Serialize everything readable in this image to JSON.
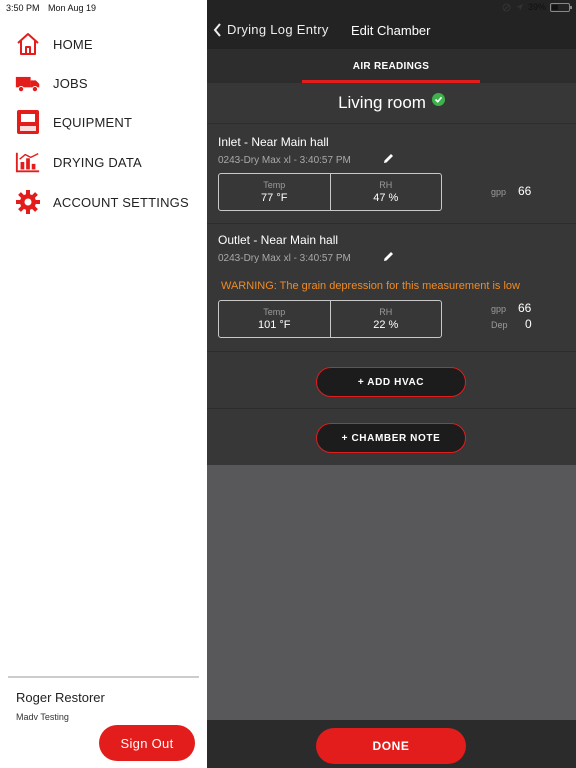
{
  "status_bar": {
    "time": "3:50 PM",
    "date": "Mon Aug 19",
    "battery": "39%"
  },
  "sidebar": {
    "items": [
      {
        "label": "HOME",
        "icon": "home-icon"
      },
      {
        "label": "JOBS",
        "icon": "truck-icon"
      },
      {
        "label": "EQUIPMENT",
        "icon": "dehumidifier-icon"
      },
      {
        "label": "DRYING DATA",
        "icon": "chart-icon"
      },
      {
        "label": "ACCOUNT SETTINGS",
        "icon": "gear-icon"
      }
    ],
    "user_name": "Roger Restorer",
    "user_org": "Madv Testing",
    "sign_out_label": "Sign Out"
  },
  "header": {
    "back_label": "Drying Log Entry",
    "title": "Edit Chamber"
  },
  "tabs": {
    "active": "AIR READINGS"
  },
  "chamber": {
    "name": "Living room",
    "readings": [
      {
        "name": "Inlet - Near Main hall",
        "equipment": "0243-Dry Max xl - 3:40:57 PM",
        "temp_label": "Temp",
        "temp_value": "77 °F",
        "rh_label": "RH",
        "rh_value": "47 %",
        "gpp_label": "gpp",
        "gpp_value": "66"
      },
      {
        "name": "Outlet - Near Main hall",
        "equipment": "0243-Dry Max xl - 3:40:57 PM",
        "warning": "WARNING: The grain depression for this measurement is low",
        "temp_label": "Temp",
        "temp_value": "101 °F",
        "rh_label": "RH",
        "rh_value": "22 %",
        "gpp_label": "gpp",
        "gpp_value": "66",
        "dep_label": "Dep",
        "dep_value": "0"
      }
    ]
  },
  "actions": {
    "add_hvac": "+ ADD HVAC",
    "chamber_note": "+ CHAMBER NOTE",
    "done": "DONE"
  },
  "colors": {
    "accent": "#e31c1c",
    "warning": "#f08a24",
    "success": "#3db24a"
  }
}
